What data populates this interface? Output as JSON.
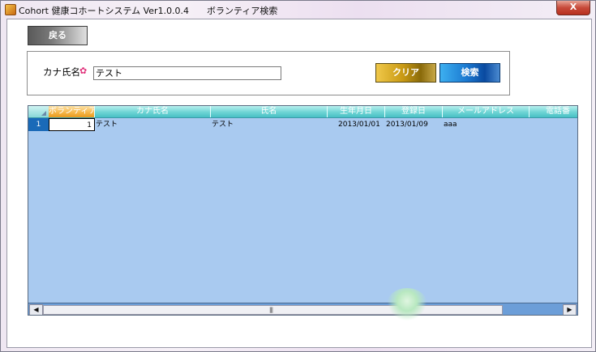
{
  "window": {
    "title": "Cohort 健康コホートシステム Ver1.0.0.4　　ボランティア検索",
    "close_label": "X"
  },
  "toolbar": {
    "back_label": "戻る"
  },
  "search": {
    "kana_label": "カナ氏名",
    "required_mark": "✿",
    "kana_value": "テスト",
    "clear_label": "クリア",
    "search_label": "検索"
  },
  "grid": {
    "columns": [
      "ボランティアID",
      "カナ氏名",
      "氏名",
      "生年月日",
      "登録日",
      "メールアドレス",
      "電話番"
    ],
    "rows": [
      {
        "row_number": "1",
        "cells": [
          "1",
          "テスト",
          "テスト",
          "2013/01/01",
          "2013/01/09",
          "aaa",
          ""
        ]
      }
    ]
  },
  "scrollbar": {
    "left_arrow": "◀",
    "right_arrow": "▶",
    "grip": "|||"
  },
  "colors": {
    "grid_background": "#a9caf0",
    "header_teal": "#6ed4d4",
    "selected_header": "#f5b445",
    "row_header_blue": "#1a6ab8"
  }
}
